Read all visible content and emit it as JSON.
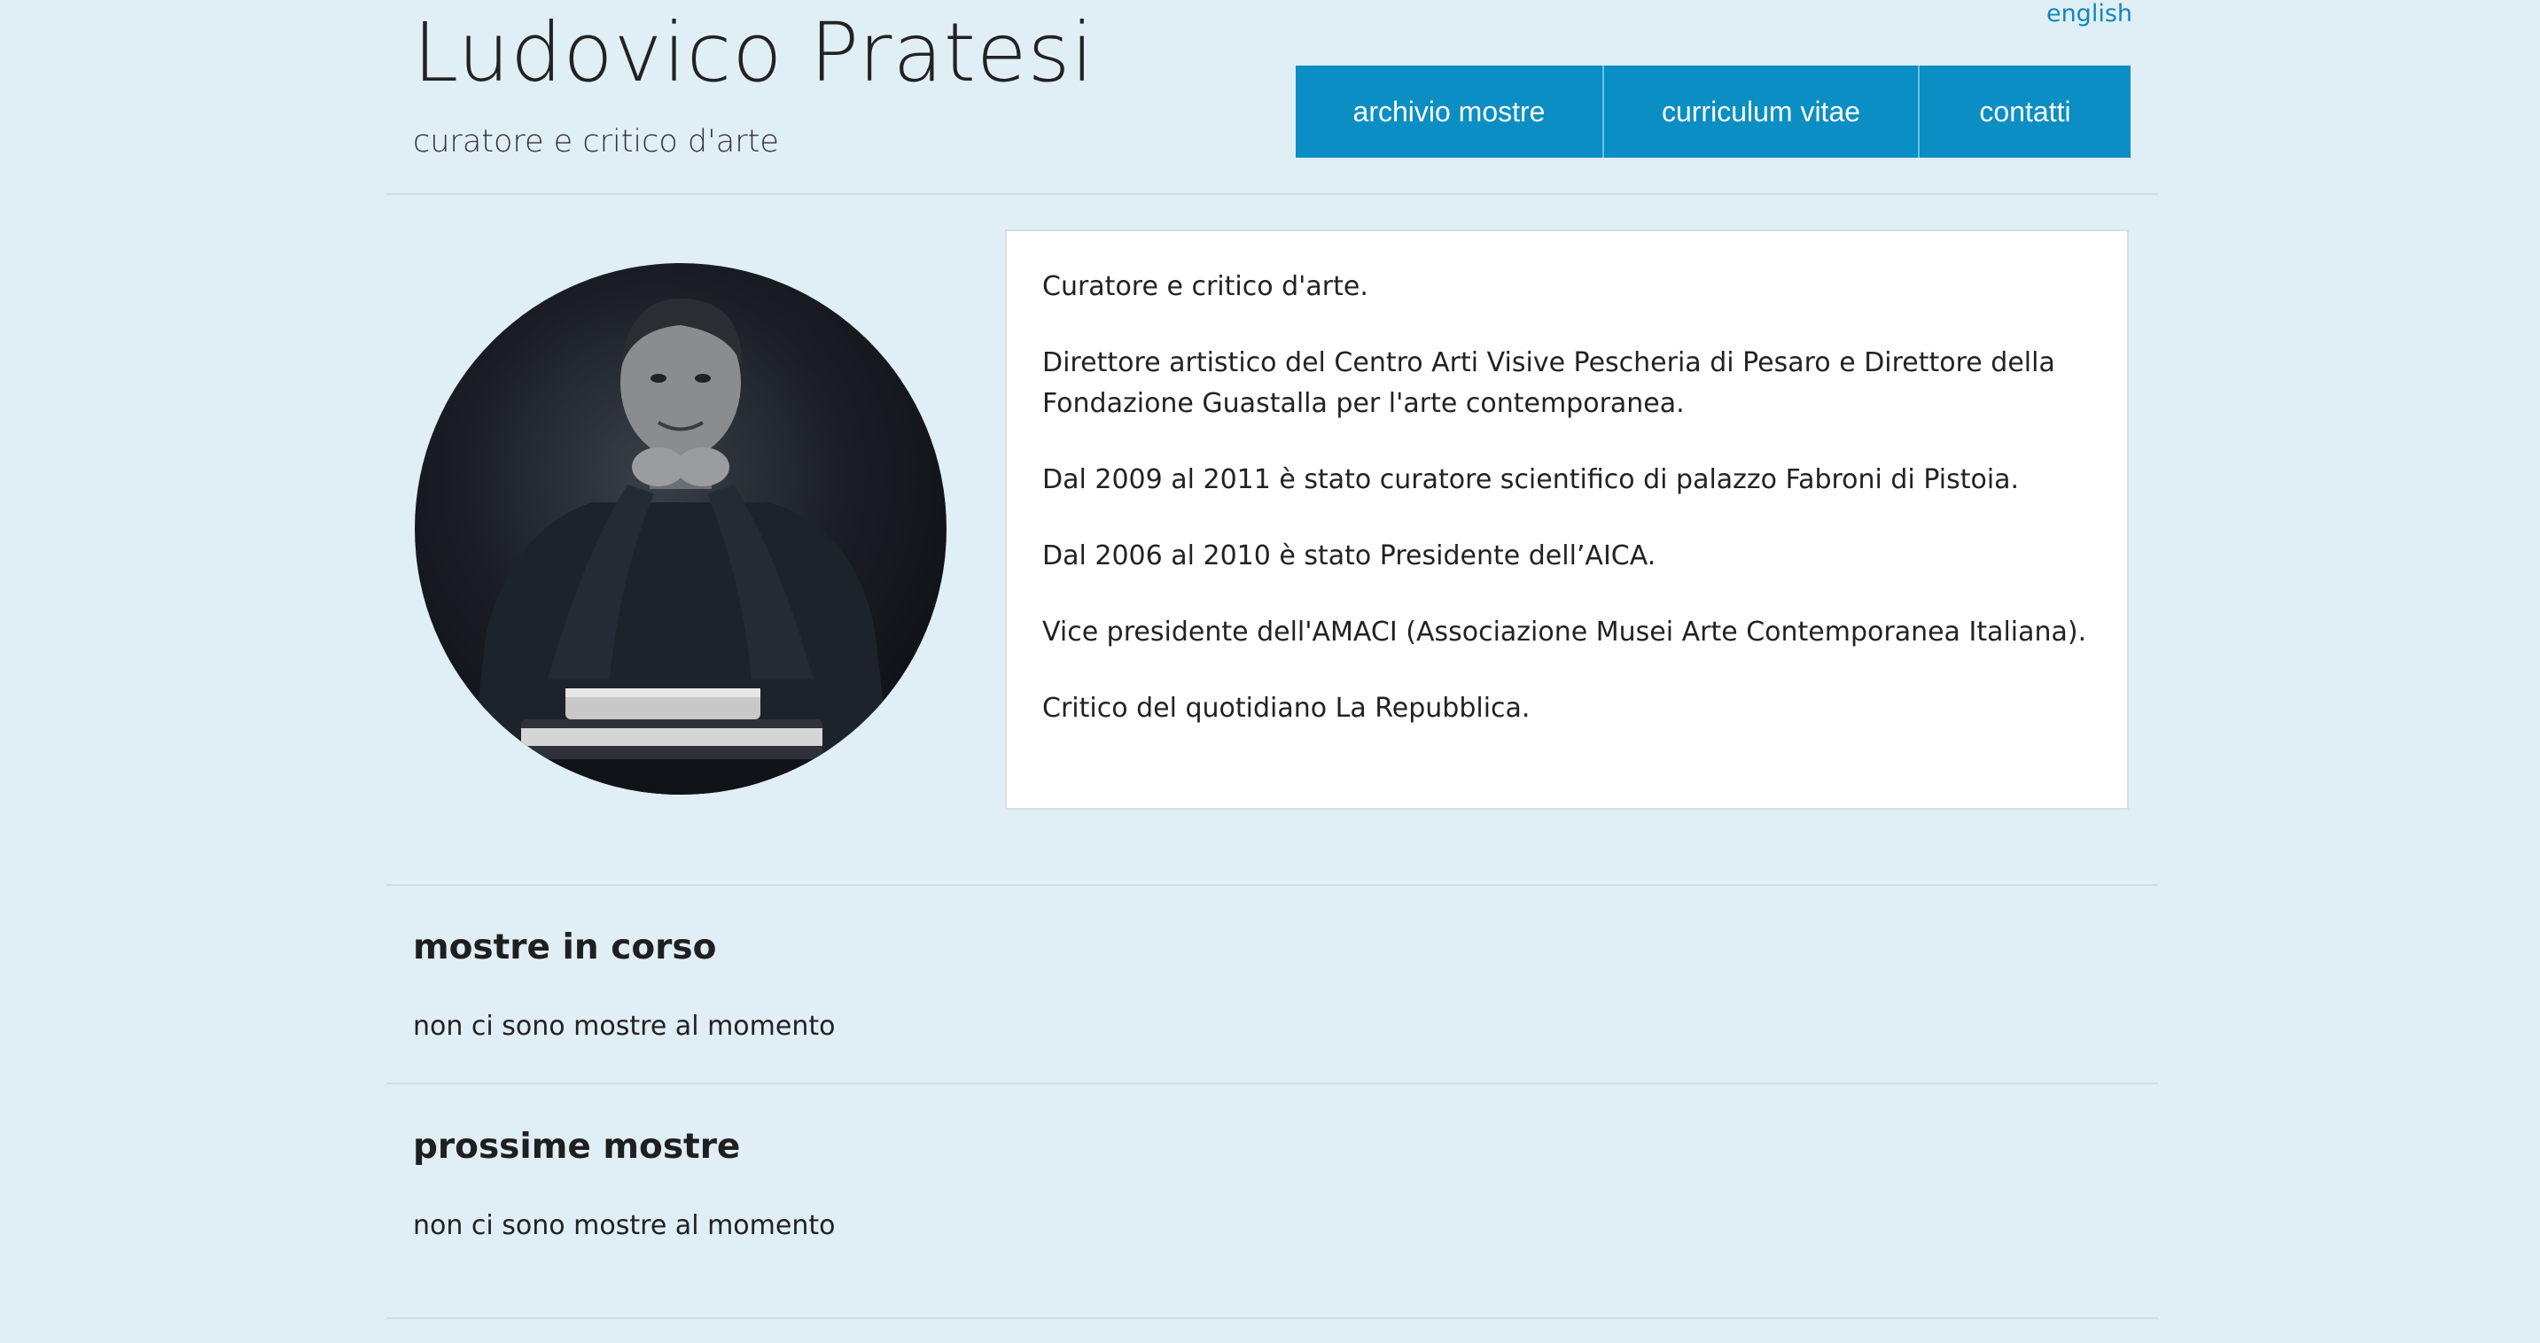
{
  "header": {
    "language_link": "english",
    "title": "Ludovico Pratesi",
    "subtitle": "curatore e critico d'arte"
  },
  "nav": {
    "items": [
      {
        "label": "archivio mostre"
      },
      {
        "label": "curriculum vitae"
      },
      {
        "label": "contatti"
      }
    ]
  },
  "bio": {
    "paragraphs": [
      "Curatore e critico d'arte.",
      "Direttore artistico del Centro Arti Visive Pescheria di Pesaro e Direttore della Fondazione Guastalla per l'arte contemporanea.",
      "Dal 2009 al 2011 è stato curatore scientifico di palazzo Fabroni di Pistoia.",
      "Dal 2006 al 2010 è stato Presidente dell’AICA.",
      "Vice presidente dell'AMACI (Associazione Musei Arte Contemporanea Italiana).",
      "Critico del quotidiano La Repubblica."
    ]
  },
  "sections": {
    "current": {
      "title": "mostre in corso",
      "text": "non ci sono mostre al momento"
    },
    "upcoming": {
      "title": "prossime mostre",
      "text": "non ci sono mostre al momento"
    }
  },
  "colors": {
    "background": "#e0eef5",
    "nav_background": "#0a8ec3",
    "link": "#1188bb"
  }
}
